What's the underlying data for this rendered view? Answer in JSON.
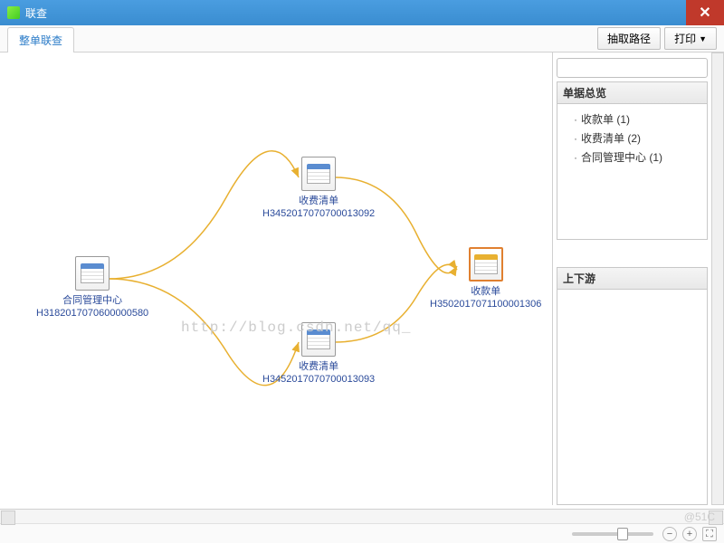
{
  "title": "联查",
  "tab_label": "整单联查",
  "toolbar": {
    "extract_path": "抽取路径",
    "print": "打印"
  },
  "search": {
    "placeholder": ""
  },
  "panels": {
    "overview": "单据总览",
    "updown": "上下游"
  },
  "tree": {
    "item1": "收款单 (1)",
    "item2": "收费清单 (2)",
    "item3": "合同管理中心 (1)"
  },
  "nodes": {
    "contract": {
      "name": "合同管理中心",
      "code": "H3182017070600000580"
    },
    "fee1": {
      "name": "收费清单",
      "code": "H3452017070700013092"
    },
    "fee2": {
      "name": "收费清单",
      "code": "H3452017070700013093"
    },
    "receipt": {
      "name": "收款单",
      "code": "H3502017071100001306"
    }
  },
  "watermark": "http://blog.csdn.net/qq_",
  "corner": "@51C"
}
